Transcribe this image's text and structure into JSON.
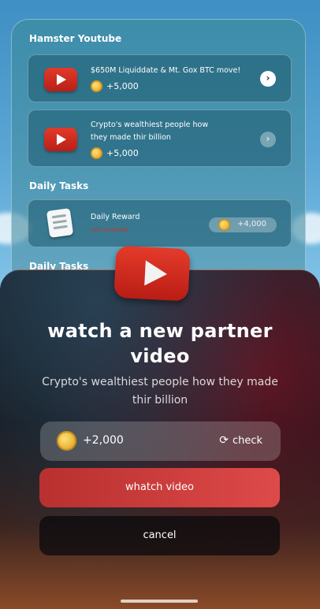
{
  "youtube_section": {
    "title": "Hamster Youtube",
    "tasks": [
      {
        "title": "$650M Liquiddate & Mt. Gox BTC move!",
        "reward": "+5,000"
      },
      {
        "title": "Crypto's wealthiest people how they made thir billion",
        "reward": "+5,000"
      }
    ]
  },
  "daily_section": {
    "title": "Daily Tasks",
    "task": {
      "title": "Daily Reward",
      "status": "not received",
      "reward": "+4,000"
    }
  },
  "daily_section_2": {
    "title": "Daily Tasks"
  },
  "sheet": {
    "title": "watch a new partner video",
    "subtitle": "Crypto's wealthiest people how they made thir billion",
    "reward": "+2,000",
    "check_label": "check",
    "watch_label": "whatch video",
    "cancel_label": "cancel"
  },
  "icons": {
    "youtube": "youtube-icon",
    "coin": "coin-icon",
    "chevron": "chevron-right-icon",
    "notes": "notes-icon",
    "refresh": "refresh-icon"
  },
  "colors": {
    "youtube_red": "#d32a1f",
    "watch_button": "#d0403f",
    "coin_gold": "#e3a92a"
  }
}
